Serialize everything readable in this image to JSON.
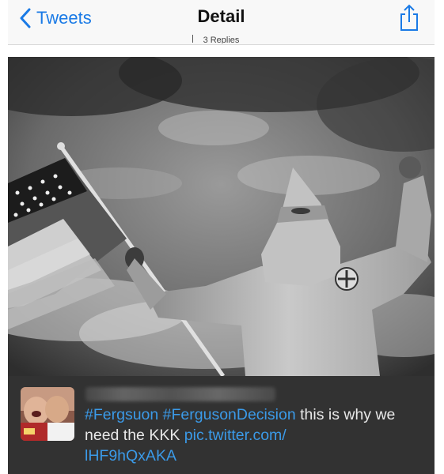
{
  "navbar": {
    "back_label": "Tweets",
    "title": "Detail",
    "replies_text": "3 Replies"
  },
  "tweet": {
    "hashtag_1": "#Fergsuon",
    "hashtag_2": "#FergusonDecision",
    "text": "this is why we need the KKK",
    "link_1": "pic.twitter.com/",
    "link_2": "lHF9hQxAKA"
  },
  "colors": {
    "accent": "#1a7ae6",
    "link": "#3b9ae8",
    "card_background": "#323232"
  },
  "icons": [
    "chevron-left-icon",
    "share-icon"
  ]
}
